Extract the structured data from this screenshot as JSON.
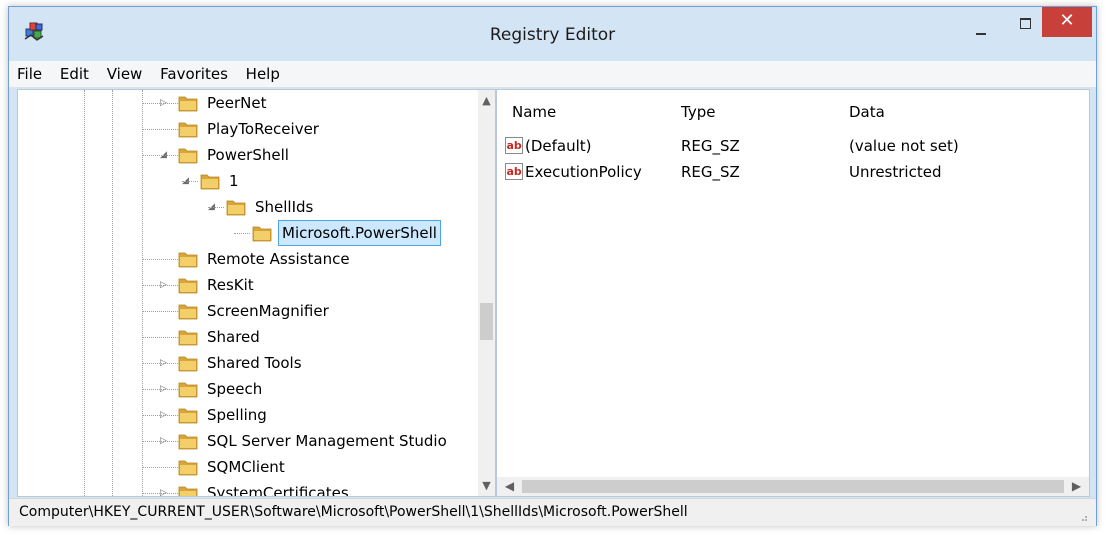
{
  "window": {
    "title": "Registry Editor",
    "close_glyph": "✕"
  },
  "menu": [
    "File",
    "Edit",
    "View",
    "Favorites",
    "Help"
  ],
  "tree": {
    "nodes": [
      {
        "label": "PeerNet",
        "expander": "collapsed"
      },
      {
        "label": "PlayToReceiver",
        "expander": "none"
      },
      {
        "label": "PowerShell",
        "expander": "expanded"
      },
      {
        "label": "1",
        "expander": "expanded"
      },
      {
        "label": "ShellIds",
        "expander": "expanded"
      },
      {
        "label": "Microsoft.PowerShell",
        "expander": "none",
        "selected": true
      },
      {
        "label": "Remote Assistance",
        "expander": "none"
      },
      {
        "label": "ResKit",
        "expander": "collapsed"
      },
      {
        "label": "ScreenMagnifier",
        "expander": "none"
      },
      {
        "label": "Shared",
        "expander": "none"
      },
      {
        "label": "Shared Tools",
        "expander": "collapsed"
      },
      {
        "label": "Speech",
        "expander": "collapsed"
      },
      {
        "label": "Spelling",
        "expander": "collapsed"
      },
      {
        "label": "SQL Server Management Studio",
        "expander": "collapsed"
      },
      {
        "label": "SQMClient",
        "expander": "none"
      },
      {
        "label": "SystemCertificates",
        "expander": "collapsed"
      }
    ]
  },
  "values": {
    "columns": {
      "name": "Name",
      "type": "Type",
      "data": "Data"
    },
    "rows": [
      {
        "name": "(Default)",
        "type": "REG_SZ",
        "data": "(value not set)"
      },
      {
        "name": "ExecutionPolicy",
        "type": "REG_SZ",
        "data": "Unrestricted"
      }
    ]
  },
  "statusbar": {
    "path": "Computer\\HKEY_CURRENT_USER\\Software\\Microsoft\\PowerShell\\1\\ShellIds\\Microsoft.PowerShell"
  },
  "icons": {
    "app": "registry-cubes-icon",
    "folder": "folder-icon",
    "string_value": "reg-sz-ab-icon"
  },
  "colors": {
    "close_button": "#c7403a",
    "selection_bg": "#cce8ff",
    "selection_border": "#4fa4e8",
    "folder": "#e8b94a"
  }
}
